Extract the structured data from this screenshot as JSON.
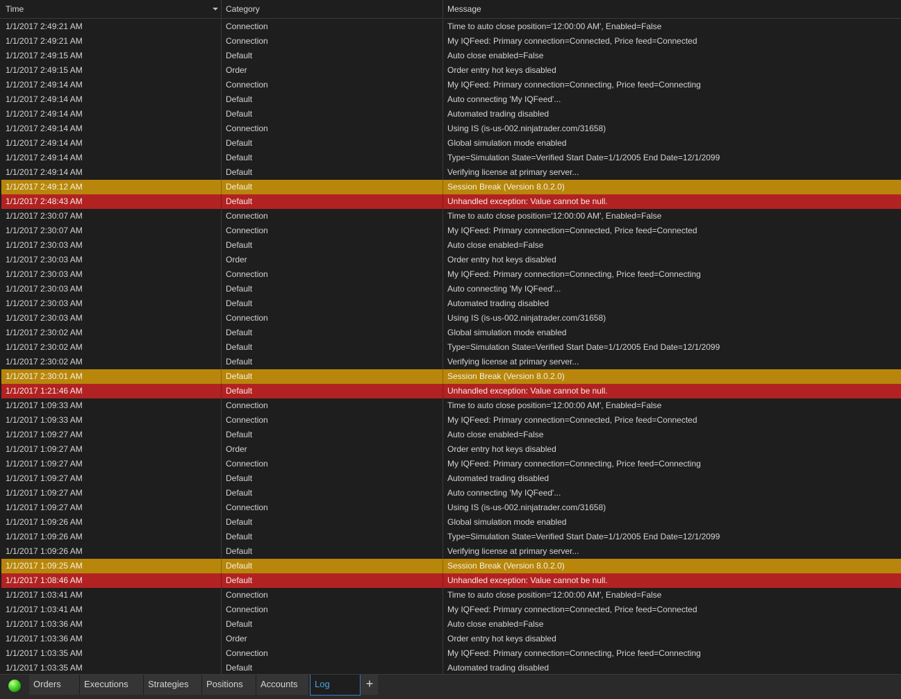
{
  "columns": [
    "Time",
    "Category",
    "Message"
  ],
  "sort": {
    "column": "Time",
    "direction": "descending",
    "icon": "sort-down-triangle-icon"
  },
  "colors": {
    "background": "#1e1e1e",
    "session_break": "#b8860b",
    "error": "#b22222",
    "active_tab": "#4aa3e8",
    "status_ok": "#3cc21f"
  },
  "rows": [
    {
      "time": "1/1/2017 2:49:21 AM",
      "category": "Connection",
      "message": "Time to auto close position='12:00:00 AM', Enabled=False",
      "level": "normal"
    },
    {
      "time": "1/1/2017 2:49:21 AM",
      "category": "Connection",
      "message": "My IQFeed: Primary connection=Connected, Price feed=Connected",
      "level": "normal"
    },
    {
      "time": "1/1/2017 2:49:15 AM",
      "category": "Default",
      "message": "Auto close enabled=False",
      "level": "normal"
    },
    {
      "time": "1/1/2017 2:49:15 AM",
      "category": "Order",
      "message": "Order entry hot keys disabled",
      "level": "normal"
    },
    {
      "time": "1/1/2017 2:49:14 AM",
      "category": "Connection",
      "message": "My IQFeed: Primary connection=Connecting, Price feed=Connecting",
      "level": "normal"
    },
    {
      "time": "1/1/2017 2:49:14 AM",
      "category": "Default",
      "message": "Auto connecting 'My IQFeed'...",
      "level": "normal"
    },
    {
      "time": "1/1/2017 2:49:14 AM",
      "category": "Default",
      "message": "Automated trading disabled",
      "level": "normal"
    },
    {
      "time": "1/1/2017 2:49:14 AM",
      "category": "Connection",
      "message": "Using IS (is-us-002.ninjatrader.com/31658)",
      "level": "normal"
    },
    {
      "time": "1/1/2017 2:49:14 AM",
      "category": "Default",
      "message": "Global simulation mode enabled",
      "level": "normal"
    },
    {
      "time": "1/1/2017 2:49:14 AM",
      "category": "Default",
      "message": "Type=Simulation State=Verified Start Date=1/1/2005 End Date=12/1/2099",
      "level": "normal"
    },
    {
      "time": "1/1/2017 2:49:14 AM",
      "category": "Default",
      "message": "Verifying license at primary server...",
      "level": "normal"
    },
    {
      "time": "1/1/2017 2:49:12 AM",
      "category": "Default",
      "message": "Session Break (Version 8.0.2.0)",
      "level": "session"
    },
    {
      "time": "1/1/2017 2:48:43 AM",
      "category": "Default",
      "message": "Unhandled exception: Value cannot be null.",
      "level": "error"
    },
    {
      "time": "1/1/2017 2:30:07 AM",
      "category": "Connection",
      "message": "Time to auto close position='12:00:00 AM', Enabled=False",
      "level": "normal"
    },
    {
      "time": "1/1/2017 2:30:07 AM",
      "category": "Connection",
      "message": "My IQFeed: Primary connection=Connected, Price feed=Connected",
      "level": "normal"
    },
    {
      "time": "1/1/2017 2:30:03 AM",
      "category": "Default",
      "message": "Auto close enabled=False",
      "level": "normal"
    },
    {
      "time": "1/1/2017 2:30:03 AM",
      "category": "Order",
      "message": "Order entry hot keys disabled",
      "level": "normal"
    },
    {
      "time": "1/1/2017 2:30:03 AM",
      "category": "Connection",
      "message": "My IQFeed: Primary connection=Connecting, Price feed=Connecting",
      "level": "normal"
    },
    {
      "time": "1/1/2017 2:30:03 AM",
      "category": "Default",
      "message": "Auto connecting 'My IQFeed'...",
      "level": "normal"
    },
    {
      "time": "1/1/2017 2:30:03 AM",
      "category": "Default",
      "message": "Automated trading disabled",
      "level": "normal"
    },
    {
      "time": "1/1/2017 2:30:03 AM",
      "category": "Connection",
      "message": "Using IS (is-us-002.ninjatrader.com/31658)",
      "level": "normal"
    },
    {
      "time": "1/1/2017 2:30:02 AM",
      "category": "Default",
      "message": "Global simulation mode enabled",
      "level": "normal"
    },
    {
      "time": "1/1/2017 2:30:02 AM",
      "category": "Default",
      "message": "Type=Simulation State=Verified Start Date=1/1/2005 End Date=12/1/2099",
      "level": "normal"
    },
    {
      "time": "1/1/2017 2:30:02 AM",
      "category": "Default",
      "message": "Verifying license at primary server...",
      "level": "normal"
    },
    {
      "time": "1/1/2017 2:30:01 AM",
      "category": "Default",
      "message": "Session Break (Version 8.0.2.0)",
      "level": "session"
    },
    {
      "time": "1/1/2017 1:21:46 AM",
      "category": "Default",
      "message": "Unhandled exception: Value cannot be null.",
      "level": "error"
    },
    {
      "time": "1/1/2017 1:09:33 AM",
      "category": "Connection",
      "message": "Time to auto close position='12:00:00 AM', Enabled=False",
      "level": "normal"
    },
    {
      "time": "1/1/2017 1:09:33 AM",
      "category": "Connection",
      "message": "My IQFeed: Primary connection=Connected, Price feed=Connected",
      "level": "normal"
    },
    {
      "time": "1/1/2017 1:09:27 AM",
      "category": "Default",
      "message": "Auto close enabled=False",
      "level": "normal"
    },
    {
      "time": "1/1/2017 1:09:27 AM",
      "category": "Order",
      "message": "Order entry hot keys disabled",
      "level": "normal"
    },
    {
      "time": "1/1/2017 1:09:27 AM",
      "category": "Connection",
      "message": "My IQFeed: Primary connection=Connecting, Price feed=Connecting",
      "level": "normal"
    },
    {
      "time": "1/1/2017 1:09:27 AM",
      "category": "Default",
      "message": "Automated trading disabled",
      "level": "normal"
    },
    {
      "time": "1/1/2017 1:09:27 AM",
      "category": "Default",
      "message": "Auto connecting 'My IQFeed'...",
      "level": "normal"
    },
    {
      "time": "1/1/2017 1:09:27 AM",
      "category": "Connection",
      "message": "Using IS (is-us-002.ninjatrader.com/31658)",
      "level": "normal"
    },
    {
      "time": "1/1/2017 1:09:26 AM",
      "category": "Default",
      "message": "Global simulation mode enabled",
      "level": "normal"
    },
    {
      "time": "1/1/2017 1:09:26 AM",
      "category": "Default",
      "message": "Type=Simulation State=Verified Start Date=1/1/2005 End Date=12/1/2099",
      "level": "normal"
    },
    {
      "time": "1/1/2017 1:09:26 AM",
      "category": "Default",
      "message": "Verifying license at primary server...",
      "level": "normal"
    },
    {
      "time": "1/1/2017 1:09:25 AM",
      "category": "Default",
      "message": "Session Break (Version 8.0.2.0)",
      "level": "session"
    },
    {
      "time": "1/1/2017 1:08:46 AM",
      "category": "Default",
      "message": "Unhandled exception: Value cannot be null.",
      "level": "error"
    },
    {
      "time": "1/1/2017 1:03:41 AM",
      "category": "Connection",
      "message": "Time to auto close position='12:00:00 AM', Enabled=False",
      "level": "normal"
    },
    {
      "time": "1/1/2017 1:03:41 AM",
      "category": "Connection",
      "message": "My IQFeed: Primary connection=Connected, Price feed=Connected",
      "level": "normal"
    },
    {
      "time": "1/1/2017 1:03:36 AM",
      "category": "Default",
      "message": "Auto close enabled=False",
      "level": "normal"
    },
    {
      "time": "1/1/2017 1:03:36 AM",
      "category": "Order",
      "message": "Order entry hot keys disabled",
      "level": "normal"
    },
    {
      "time": "1/1/2017 1:03:35 AM",
      "category": "Connection",
      "message": "My IQFeed: Primary connection=Connecting, Price feed=Connecting",
      "level": "normal"
    },
    {
      "time": "1/1/2017 1:03:35 AM",
      "category": "Default",
      "message": "Automated trading disabled",
      "level": "normal"
    }
  ],
  "tabbar": {
    "status_icon": "green-status-icon",
    "tabs": [
      {
        "label": "Orders",
        "active": false
      },
      {
        "label": "Executions",
        "active": false
      },
      {
        "label": "Strategies",
        "active": false
      },
      {
        "label": "Positions",
        "active": false
      },
      {
        "label": "Accounts",
        "active": false
      },
      {
        "label": "Log",
        "active": true
      }
    ],
    "add_label": "+"
  }
}
